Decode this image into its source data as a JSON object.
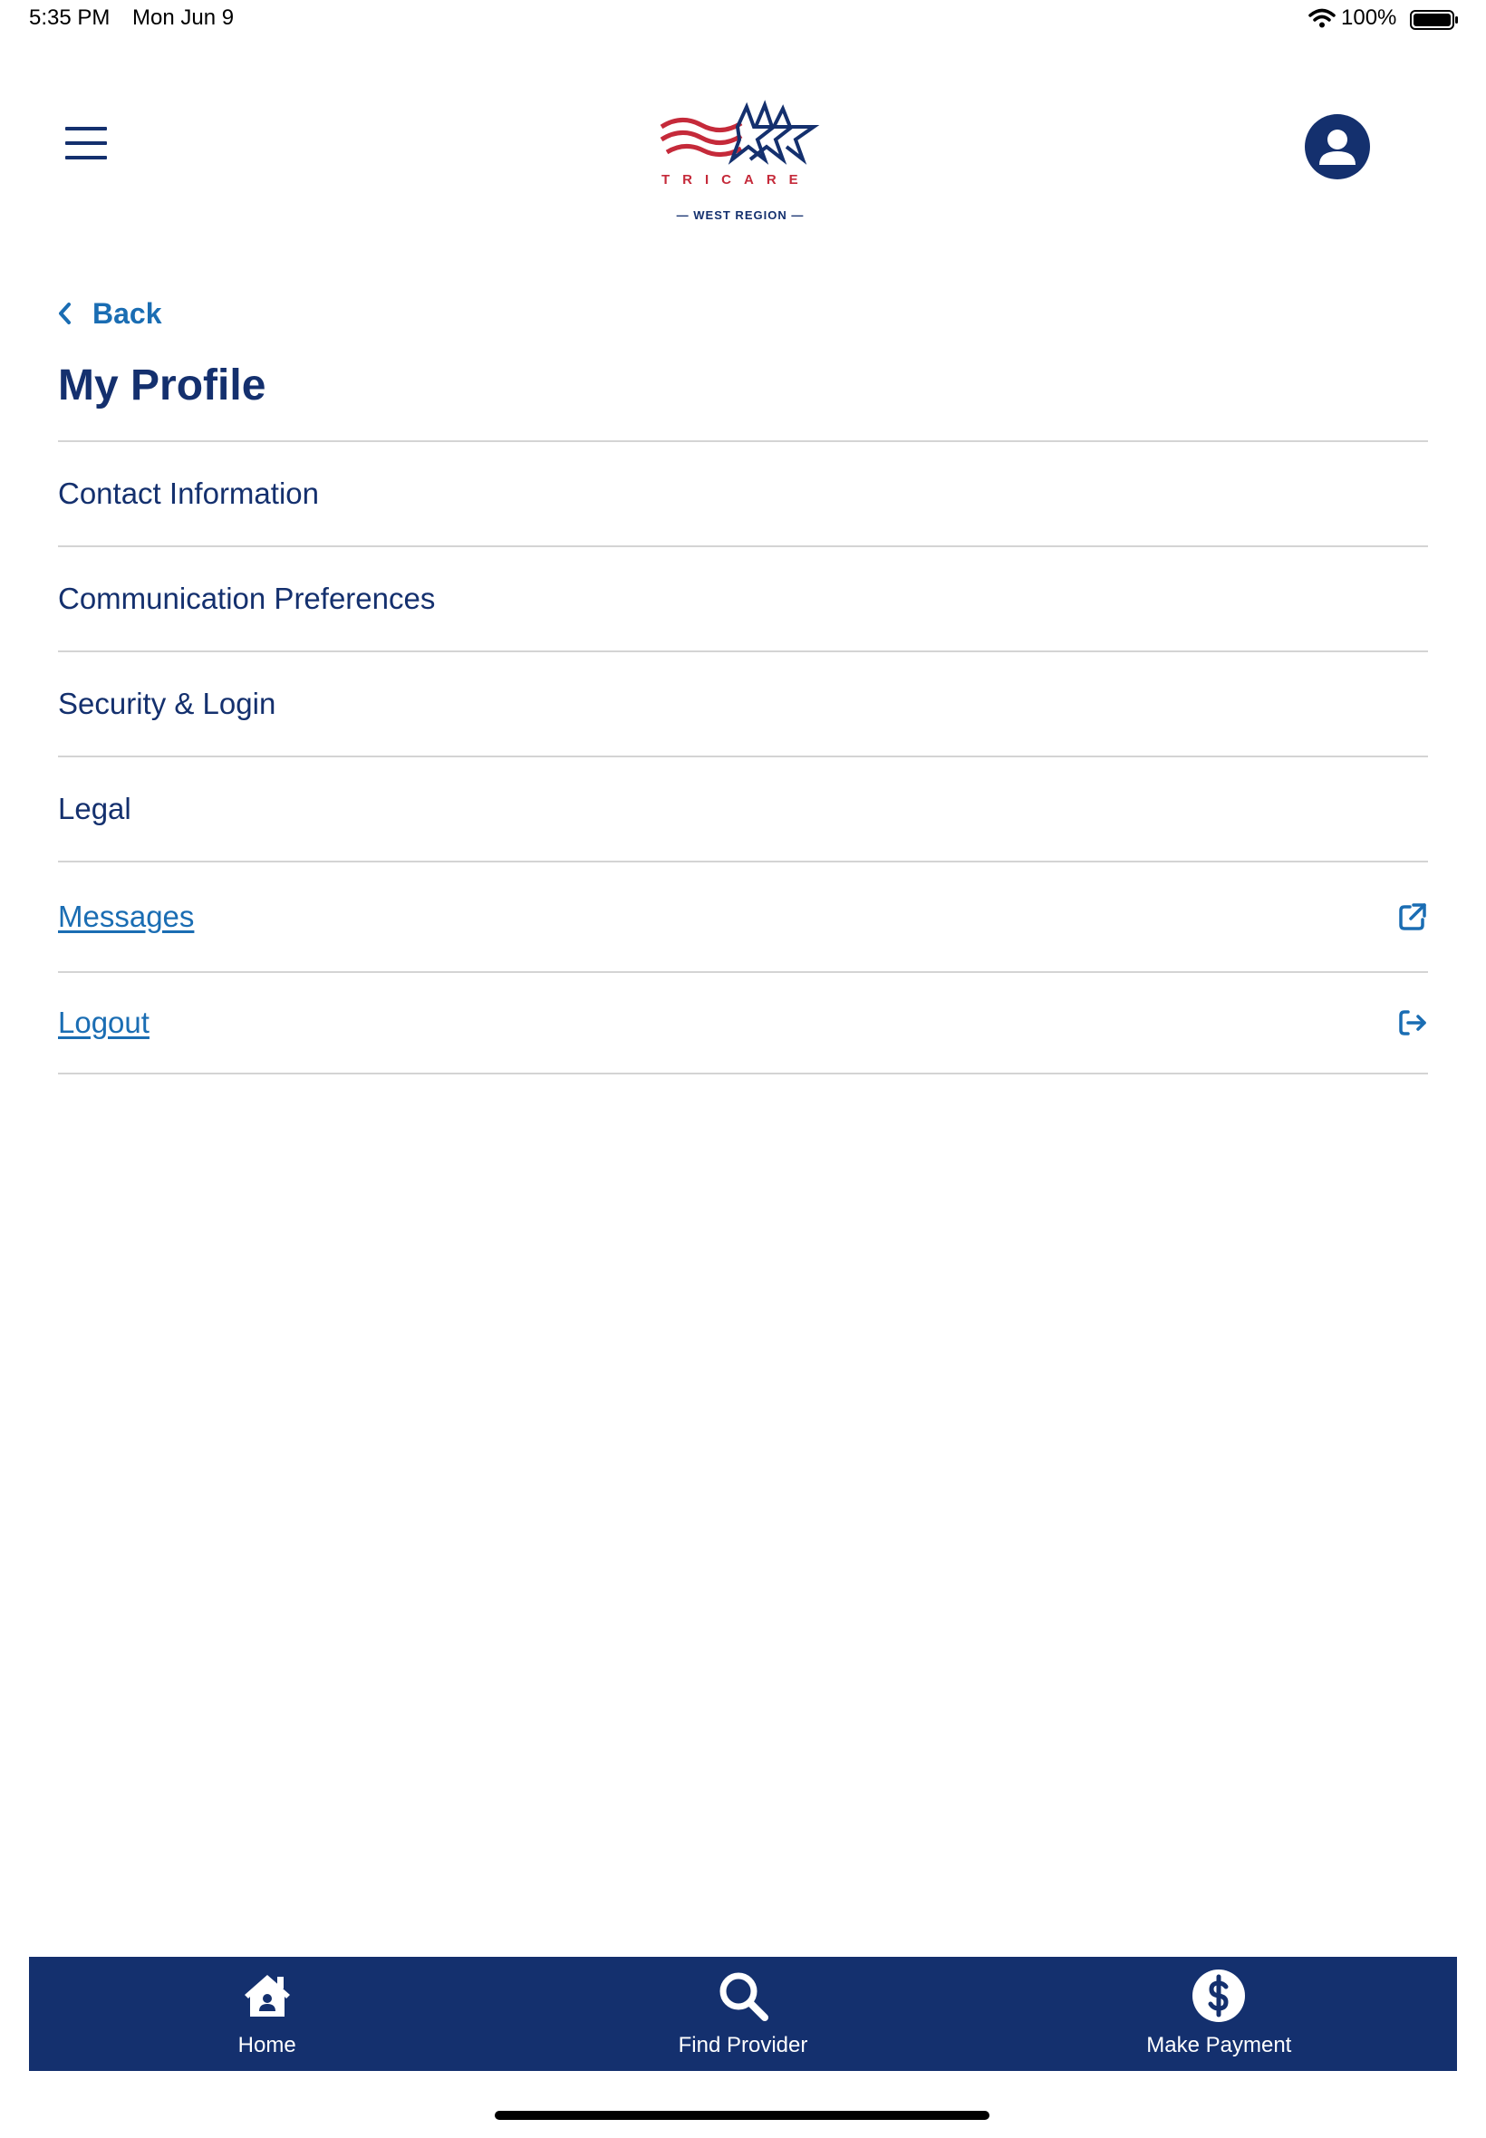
{
  "status_bar": {
    "time": "5:35 PM",
    "date": "Mon Jun 9",
    "battery": "100%"
  },
  "header": {
    "logo": {
      "wordmark": "TRICARE",
      "region": "WEST REGION"
    },
    "menu_icon": "hamburger-menu-icon",
    "account_icon": "user-account-icon"
  },
  "navigation": {
    "back_label": "Back"
  },
  "page": {
    "title": "My Profile"
  },
  "profile_menu": {
    "items": [
      {
        "label": "Contact Information"
      },
      {
        "label": "Communication Preferences"
      },
      {
        "label": "Security & Login"
      },
      {
        "label": "Legal"
      }
    ],
    "links": [
      {
        "label": "Messages",
        "icon": "external-link-icon"
      },
      {
        "label": "Logout",
        "icon": "logout-icon"
      }
    ]
  },
  "bottom_nav": {
    "items": [
      {
        "label": "Home",
        "icon": "home-icon"
      },
      {
        "label": "Find Provider",
        "icon": "search-icon"
      },
      {
        "label": "Make Payment",
        "icon": "dollar-circle-icon"
      }
    ]
  },
  "colors": {
    "brand_navy": "#14306e",
    "link_blue": "#1a6db3",
    "brand_red": "#c52a3a",
    "divider": "#d4d4d4"
  }
}
